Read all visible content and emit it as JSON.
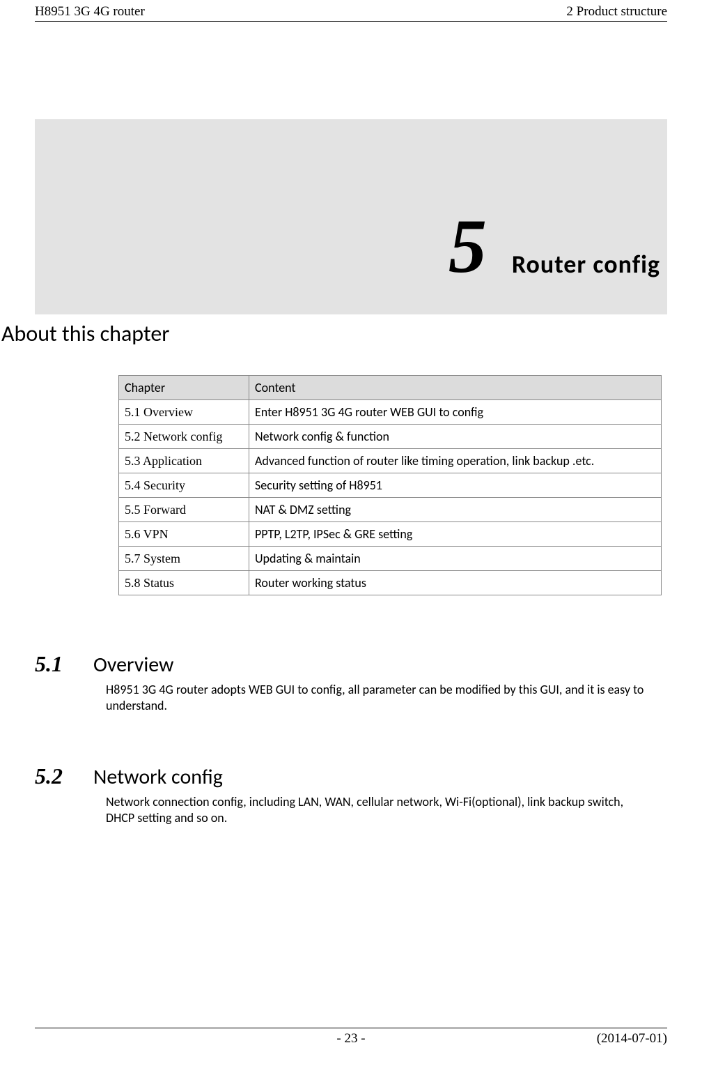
{
  "header": {
    "left": "H8951 3G 4G router",
    "right": "2  Product structure"
  },
  "banner": {
    "number": "5",
    "title": "Router  config"
  },
  "about_heading": "About this chapter",
  "table": {
    "headers": {
      "chapter": "Chapter",
      "content": "Content"
    },
    "rows": [
      {
        "chapter": "5.1 Overview",
        "content": "Enter H8951 3G 4G router    WEB GUI to config"
      },
      {
        "chapter": "5.2 Network config",
        "content": "Network config & function"
      },
      {
        "chapter": "5.3 Application",
        "content": "Advanced function of router like timing operation, link backup .etc."
      },
      {
        "chapter": "5.4 Security",
        "content": "Security setting of H8951"
      },
      {
        "chapter": "5.5 Forward",
        "content": "NAT & DMZ setting"
      },
      {
        "chapter": "5.6 VPN",
        "content": "PPTP, L2TP, IPSec & GRE setting"
      },
      {
        "chapter": "5.7 System",
        "content": "Updating & maintain"
      },
      {
        "chapter": "5.8 Status",
        "content": "Router working status"
      }
    ]
  },
  "sections": [
    {
      "num": "5.1",
      "title": "Overview",
      "body": "H8951 3G 4G router    adopts WEB GUI to config, all parameter can be modified by this GUI, and it is easy to understand."
    },
    {
      "num": "5.2",
      "title": "Network config",
      "body": "Network connection config, including LAN, WAN, cellular network, Wi-Fi(optional), link backup switch, DHCP setting and so on."
    }
  ],
  "footer": {
    "page": "- 23 -",
    "date": "(2014-07-01)"
  }
}
